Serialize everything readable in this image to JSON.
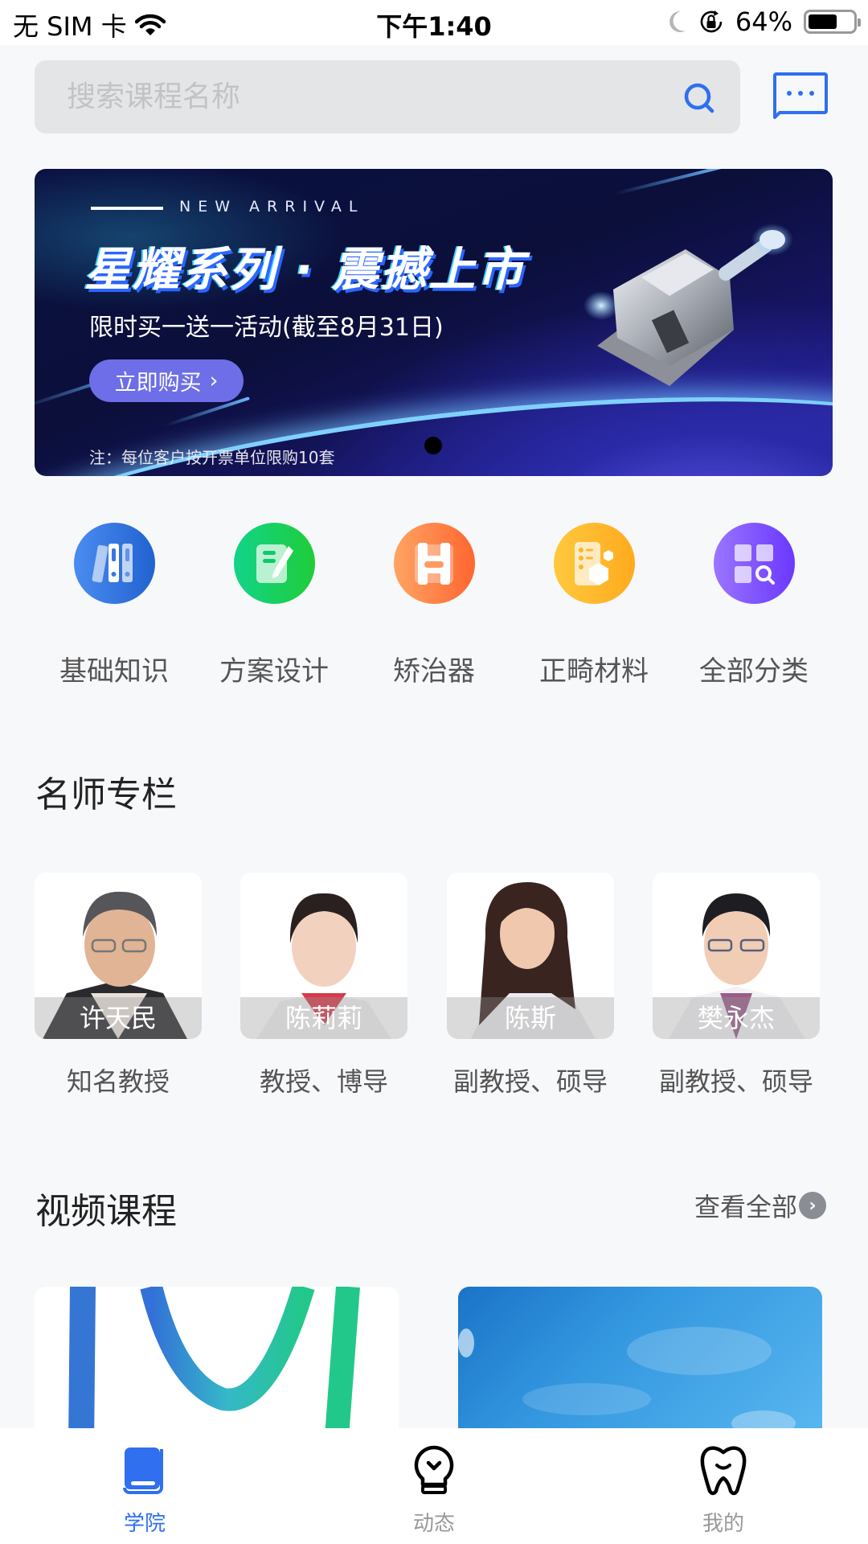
{
  "status_bar": {
    "carrier": "无 SIM 卡",
    "time": "下午1:40",
    "battery_percent": "64%",
    "battery_level": 0.64,
    "icons": [
      "wifi-icon",
      "moon-icon",
      "rotation-lock-icon",
      "battery-icon"
    ]
  },
  "search": {
    "placeholder": "搜索课程名称",
    "value": "",
    "icon": "search-icon"
  },
  "header": {
    "message_icon": "message-icon"
  },
  "banner": {
    "tag": "NEW ARRIVAL",
    "title": "星耀系列 · 震撼上市",
    "subtitle": "限时买一送一活动(截至8月31日)",
    "button_label": "立即购买",
    "button_chevron": "›",
    "note": "注：每位客户按开票单位限购10套",
    "page_count": 1,
    "active_page": 1
  },
  "categories": [
    {
      "label": "基础知识",
      "icon": "binders-icon",
      "color_from": "#4a8cf0",
      "color_to": "#2162d0"
    },
    {
      "label": "方案设计",
      "icon": "notes-pen-icon",
      "color_from": "#12d48a",
      "color_to": "#1fcc38"
    },
    {
      "label": "矫治器",
      "icon": "bracket-icon",
      "color_from": "#ffa463",
      "color_to": "#ff6630"
    },
    {
      "label": "正畸材料",
      "icon": "materials-icon",
      "color_from": "#ffc93d",
      "color_to": "#ffaa1e"
    },
    {
      "label": "全部分类",
      "icon": "grid-search-icon",
      "color_from": "#9a75ff",
      "color_to": "#6a38ff"
    }
  ],
  "teachers_section": {
    "title": "名师专栏",
    "teachers": [
      {
        "name": "许天民",
        "role": "知名教授"
      },
      {
        "name": "陈莉莉",
        "role": "教授、博导"
      },
      {
        "name": "陈斯",
        "role": "副教授、硕导"
      },
      {
        "name": "樊永杰",
        "role": "副教授、硕导"
      }
    ]
  },
  "videos_section": {
    "title": "视频课程",
    "see_all": "查看全部",
    "see_all_chevron": "›"
  },
  "tabbar": {
    "tabs": [
      {
        "label": "学院",
        "icon": "book-icon",
        "active": true
      },
      {
        "label": "动态",
        "icon": "lightbulb-icon",
        "active": false
      },
      {
        "label": "我的",
        "icon": "tooth-icon",
        "active": false
      }
    ],
    "active_color": "#2f6ff0",
    "inactive_color": "#999999"
  }
}
